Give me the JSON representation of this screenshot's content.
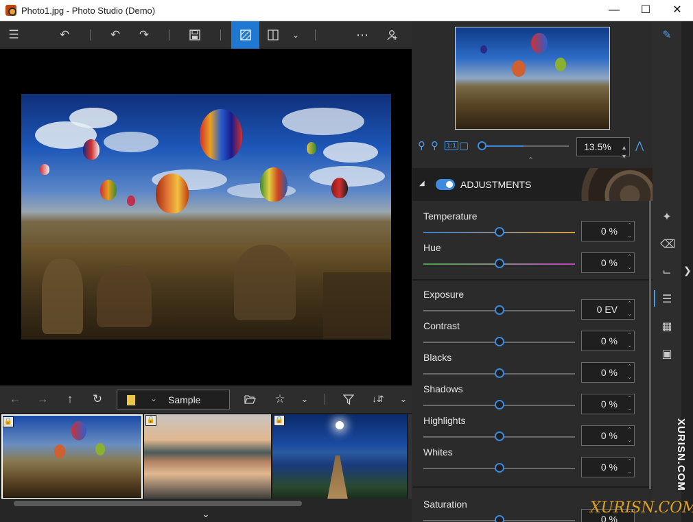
{
  "window": {
    "title": "Photo1.jpg - Photo Studio (Demo)",
    "minimize_icon": "minimize-icon",
    "maximize_icon": "maximize-icon",
    "close_icon": "close-icon"
  },
  "toolbar": {
    "icons": [
      "menu-icon",
      "undo-all-icon",
      "undo-icon",
      "redo-icon",
      "save-icon",
      "compare-view-icon",
      "split-view-icon",
      "chevron-down-icon",
      "more-icon",
      "add-user-icon"
    ]
  },
  "navigation": {
    "folder_name": "Sample",
    "icons": [
      "back-icon",
      "forward-icon",
      "up-icon",
      "refresh-icon",
      "open-folder-icon",
      "star-filter-icon",
      "chevron-down-icon",
      "filter-icon",
      "sort-icon",
      "chevron-down-icon"
    ]
  },
  "thumbnails": [
    {
      "name": "balloons",
      "selected": true
    },
    {
      "name": "lake-sunset",
      "selected": false
    },
    {
      "name": "moon-pier",
      "selected": false
    }
  ],
  "zoom": {
    "value": "13.5%",
    "level": 0.135
  },
  "adjustments": {
    "header": "ADJUSTMENTS",
    "enabled": true,
    "group1": [
      {
        "label": "Temperature",
        "value": "0 %"
      },
      {
        "label": "Hue",
        "value": "0 %"
      }
    ],
    "group2": [
      {
        "label": "Exposure",
        "value": "0 EV"
      },
      {
        "label": "Contrast",
        "value": "0 %"
      },
      {
        "label": "Blacks",
        "value": "0 %"
      },
      {
        "label": "Shadows",
        "value": "0 %"
      },
      {
        "label": "Highlights",
        "value": "0 %"
      },
      {
        "label": "Whites",
        "value": "0 %"
      }
    ],
    "group3": [
      {
        "label": "Saturation",
        "value": "0 %"
      }
    ]
  },
  "right_rail": {
    "icons": [
      "edit-icon",
      "retouch-icon",
      "eraser-icon",
      "crop-icon",
      "adjustments-icon",
      "grid-icon",
      "image-icon"
    ]
  },
  "watermark": {
    "vertical": "XURISN.COM",
    "corner": "XURISN.COM"
  },
  "colors": {
    "accent": "#3d8be0",
    "background": "#2b2b2b"
  }
}
